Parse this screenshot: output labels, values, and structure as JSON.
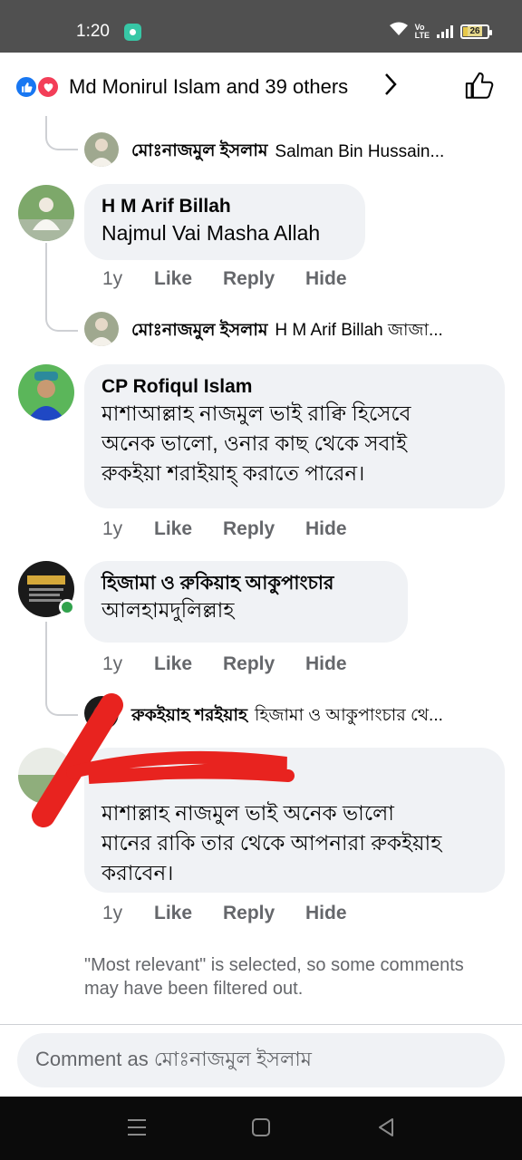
{
  "status_bar": {
    "time": "1:20",
    "network_label": "Vo\nLTE",
    "battery_level": "26"
  },
  "reactions": {
    "summary": "Md Monirul Islam and 39 others",
    "icons": [
      "like-icon",
      "love-icon"
    ]
  },
  "thread_top_reply": {
    "author": "মোঃনাজমুল ইসলাম",
    "preview": "Salman Bin Hussain..."
  },
  "comments": [
    {
      "author": "H M Arif Billah",
      "text": "Najmul Vai Masha Allah",
      "time": "1y",
      "like": "Like",
      "reply": "Reply",
      "hide": "Hide",
      "reply_preview": {
        "author": "মোঃনাজমুল ইসলাম",
        "text": "H M Arif Billah জাজা..."
      }
    },
    {
      "author": "CP Rofiqul Islam",
      "text_lines": [
        "মাশাআল্লাহ নাজমুল ভাই রাক্বি হিসেবে",
        "অনেক ভালো, ওনার কাছ থেকে সবাই",
        "রুকইয়া শরাইয়াহ্ করাতে পারেন।"
      ],
      "time": "1y",
      "like": "Like",
      "reply": "Reply",
      "hide": "Hide"
    },
    {
      "author": "হিজামা ও রুকিয়াহ আকুপাংচার",
      "text": "আলহামদুলিল্লাহ",
      "time": "1y",
      "like": "Like",
      "reply": "Reply",
      "hide": "Hide",
      "reply_preview": {
        "author": "রুকইয়াহ শরইয়াহ",
        "text": "হিজামা ও আকুপাংচার থে..."
      }
    },
    {
      "author": "",
      "text_lines": [
        "মাশাল্লাহ নাজমুল ভাই অনেক ভালো",
        "মানের রাকি তার থেকে আপনারা রুকইয়াহ",
        "করাবেন।"
      ],
      "time": "1y",
      "like": "Like",
      "reply": "Reply",
      "hide": "Hide"
    }
  ],
  "filter_note": "\"Most relevant\" is selected, so some comments may have been filtered out.",
  "comment_input": {
    "placeholder": "Comment as মোঃনাজমুল ইসলাম"
  },
  "colors": {
    "facebook_blue": "#1877f2",
    "love_red": "#f33e58",
    "bubble_gray": "#f0f2f5",
    "secondary_text": "#65676b",
    "redaction_red": "#e8231f",
    "online_green": "#31a24c"
  }
}
